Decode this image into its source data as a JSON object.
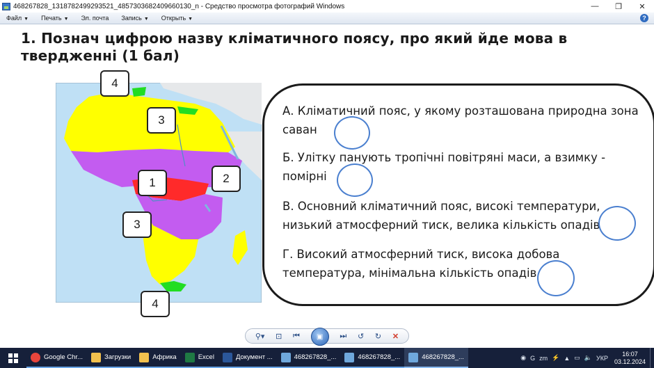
{
  "window": {
    "title": "468267828_1318782499293521_4857303682409660130_n - Средство просмотра фотографий Windows",
    "min_glyph": "—",
    "restore_glyph": "❐",
    "close_glyph": "✕"
  },
  "menu": {
    "items": [
      {
        "label": "Файл",
        "has_arrow": true
      },
      {
        "label": "Печать",
        "has_arrow": true
      },
      {
        "label": "Эл. почта",
        "has_arrow": false
      },
      {
        "label": "Запись",
        "has_arrow": true
      },
      {
        "label": "Открыть",
        "has_arrow": true
      }
    ],
    "arrow": "▼",
    "help": "?"
  },
  "question": {
    "text": "1. Познач цифрою назву кліматичного поясу, про який йде мова в твердженні (1 бал)"
  },
  "map_labels": [
    "4",
    "3",
    "1",
    "2",
    "3",
    "4"
  ],
  "statements": [
    {
      "text": "А. Кліматичний пояс, у якому розташована природна зона саван"
    },
    {
      "text": "Б. Улітку панують  тропічні повітряні маси, а взимку  - помірні"
    },
    {
      "text": "В. Основний кліматичний пояс, високі температури, низький атмосферний тиск, велика кількість опадів"
    },
    {
      "text": "Г. Високий атмосферний тиск, висока добова температура, мінімальна кількість опадів"
    }
  ],
  "viewer_controls": {
    "zoom": "⚲▾",
    "fit": "⊡",
    "prev": "⏮",
    "slideshow": "▣",
    "next": "⏭",
    "rotate_left": "↺",
    "rotate_right": "↻",
    "delete": "✕"
  },
  "taskbar": {
    "items": [
      {
        "label": "Google Chr...",
        "icon_color": "#e8453c"
      },
      {
        "label": "Загрузки",
        "icon_color": "#f2c14e"
      },
      {
        "label": "Африка",
        "icon_color": "#f2c14e"
      },
      {
        "label": "Excel",
        "icon_color": "#1f7a44"
      },
      {
        "label": "Документ ...",
        "icon_color": "#2b579a"
      },
      {
        "label": "468267828_...",
        "icon_color": "#6fa8dc"
      },
      {
        "label": "468267828_...",
        "icon_color": "#6fa8dc"
      },
      {
        "label": "468267828_...",
        "icon_color": "#6fa8dc"
      }
    ],
    "tray_icons": [
      "◉",
      "G",
      "zm",
      "⚡",
      "▲",
      "▭",
      "🔈"
    ],
    "lang": "УКР",
    "time": "16:07",
    "date": "03.12.2024"
  },
  "colors": {
    "tropical_yellow": "#ffff00",
    "equatorial_violet": "#cc66ff",
    "subequatorial_violet": "#c35cf0",
    "subtropical_green": "#22dd22",
    "ocean": "#bfe0f5",
    "answer_circle": "#4a7fcf"
  }
}
